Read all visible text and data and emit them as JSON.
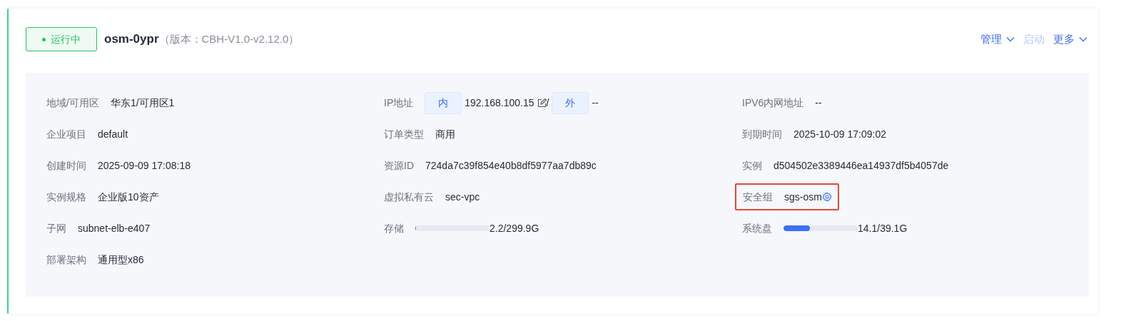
{
  "status": {
    "label": "运行中",
    "color": "#22c55e"
  },
  "title": "osm-0ypr",
  "version": "（版本：CBH-V1.0-v2.12.0）",
  "actions": [
    {
      "label": "管理",
      "disabled": false,
      "dropdown": true
    },
    {
      "label": "启动",
      "disabled": true,
      "dropdown": false
    },
    {
      "label": "更多",
      "disabled": false,
      "dropdown": true
    }
  ],
  "fields": [
    {
      "kind": "text",
      "label": "地域/可用区",
      "value": "华东1/可用区1"
    },
    {
      "kind": "ip",
      "label": "IP地址",
      "inner_tag": "内",
      "inner_value": "192.168.100.15",
      "separator": "/",
      "outer_tag": "外",
      "outer_value": "--"
    },
    {
      "kind": "text",
      "label": "IPV6内网地址",
      "value": "--"
    },
    {
      "kind": "text",
      "label": "企业项目",
      "value": "default"
    },
    {
      "kind": "text",
      "label": "订单类型",
      "value": "商用"
    },
    {
      "kind": "text",
      "label": "到期时间",
      "value": "2025-10-09 17:09:02"
    },
    {
      "kind": "text",
      "label": "创建时间",
      "value": "2025-09-09 17:08:18"
    },
    {
      "kind": "text",
      "label": "资源ID",
      "value": "724da7c39f854e40b8df5977aa7db89c"
    },
    {
      "kind": "text",
      "label": "实例",
      "value": "d504502e3389446ea14937df5b4057de"
    },
    {
      "kind": "text",
      "label": "实例规格",
      "value": "企业版10资产"
    },
    {
      "kind": "text",
      "label": "虚拟私有云",
      "value": "sec-vpc"
    },
    {
      "kind": "setting",
      "label": "安全组",
      "value": "sgs-osm",
      "highlighted": true
    },
    {
      "kind": "text",
      "label": "子网",
      "value": "subnet-elb-e407"
    },
    {
      "kind": "meter",
      "label": "存储",
      "level": 0.007,
      "value": "2.2/299.9G"
    },
    {
      "kind": "meter",
      "label": "系统盘",
      "level": 0.36,
      "value": "14.1/39.1G"
    },
    {
      "kind": "text",
      "label": "部署架构",
      "value": "通用型x86"
    }
  ]
}
